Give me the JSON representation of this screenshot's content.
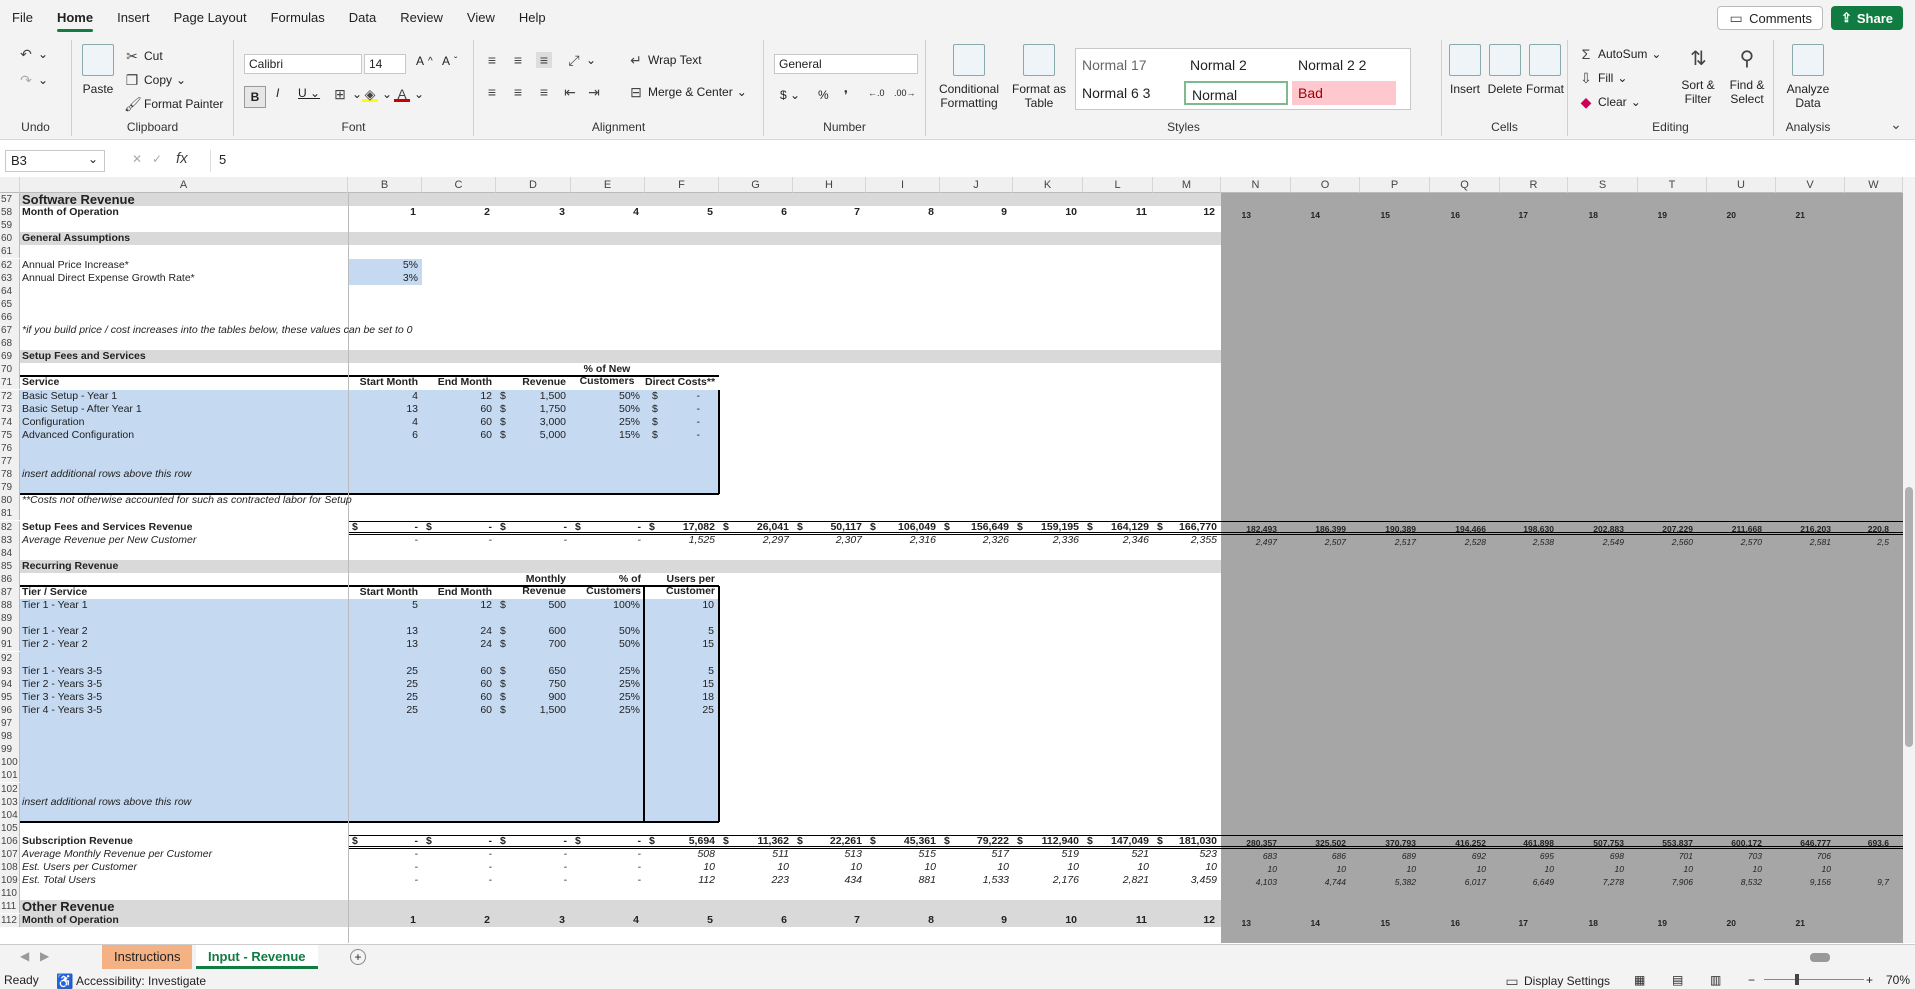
{
  "menu": {
    "items": [
      "File",
      "Home",
      "Insert",
      "Page Layout",
      "Formulas",
      "Data",
      "Review",
      "View",
      "Help"
    ],
    "comments": "Comments",
    "share": "Share"
  },
  "ribbon": {
    "undo": "Undo",
    "clipboard": {
      "paste": "Paste",
      "cut": "Cut",
      "copy": "Copy",
      "format_painter": "Format Painter",
      "label": "Clipboard"
    },
    "font": {
      "name": "Calibri",
      "size": "14",
      "label": "Font"
    },
    "alignment": {
      "wrap": "Wrap Text",
      "merge": "Merge & Center",
      "label": "Alignment"
    },
    "number": {
      "format": "General",
      "label": "Number"
    },
    "styles": {
      "conditional": "Conditional Formatting",
      "format_table": "Format as Table",
      "cells": [
        "Normal 17",
        "Normal 2",
        "Normal 2 2",
        "Normal 6 3",
        "Normal",
        "Bad"
      ],
      "label": "Styles"
    },
    "cells": {
      "insert": "Insert",
      "delete": "Delete",
      "format": "Format",
      "label": "Cells"
    },
    "editing": {
      "autosum": "AutoSum",
      "fill": "Fill",
      "clear": "Clear",
      "sort": "Sort & Filter",
      "find": "Find & Select",
      "label": "Editing"
    },
    "analysis": {
      "analyze": "Analyze Data",
      "label": "Analysis"
    }
  },
  "formula_bar": {
    "name_box": "B3",
    "value": "5"
  },
  "columns": [
    "A",
    "B",
    "C",
    "D",
    "E",
    "F",
    "G",
    "H",
    "I",
    "J",
    "K",
    "L",
    "M",
    "N",
    "O",
    "P",
    "Q",
    "R",
    "S",
    "T",
    "U",
    "V",
    "W"
  ],
  "sheet": {
    "r57": "Software Revenue",
    "r58": "Month of Operation",
    "months_a": [
      "1",
      "2",
      "3",
      "4",
      "5",
      "6",
      "7",
      "8",
      "9",
      "10",
      "11",
      "12"
    ],
    "months_b": [
      "13",
      "14",
      "15",
      "16",
      "17",
      "18",
      "19",
      "20",
      "21"
    ],
    "r60": "General Assumptions",
    "r62": "Annual Price Increase*",
    "r62v": "5%",
    "r63": "Annual Direct Expense Growth Rate*",
    "r63v": "3%",
    "r67": "*if you build price / cost increases into the tables below, these values can be set to 0",
    "r69": "Setup Fees and Services",
    "setup_hdr": [
      "Service",
      "Start Month",
      "End Month",
      "Revenue",
      "% of New Customers",
      "Direct Costs**"
    ],
    "setup_rows": [
      [
        "Basic Setup - Year 1",
        "4",
        "12",
        "$",
        "1,500",
        "50%",
        "$",
        "-"
      ],
      [
        "Basic Setup - After Year 1",
        "13",
        "60",
        "$",
        "1,750",
        "50%",
        "$",
        "-"
      ],
      [
        "Configuration",
        "4",
        "60",
        "$",
        "3,000",
        "25%",
        "$",
        "-"
      ],
      [
        "Advanced Configuration",
        "6",
        "60",
        "$",
        "5,000",
        "15%",
        "$",
        "-"
      ]
    ],
    "insert_note": "insert additional rows above this row",
    "r80": "**Costs not otherwise accounted for such as contracted labor for Setup",
    "r82": "Setup Fees and Services Revenue",
    "r82v": [
      "-",
      "-",
      "-",
      "-",
      "17,082",
      "26,041",
      "50,117",
      "106,049",
      "156,649",
      "159,195",
      "164,129",
      "166,770"
    ],
    "r82w": [
      "182,493",
      "186,399",
      "190,389",
      "194,466",
      "198,630",
      "202,883",
      "207,229",
      "211,668",
      "216,203",
      "220,8"
    ],
    "r83": "Average Revenue per New Customer",
    "r83v": [
      "-",
      "-",
      "-",
      "-",
      "1,525",
      "2,297",
      "2,307",
      "2,316",
      "2,326",
      "2,336",
      "2,346",
      "2,355"
    ],
    "r83w": [
      "2,497",
      "2,507",
      "2,517",
      "2,528",
      "2,538",
      "2,549",
      "2,560",
      "2,570",
      "2,581",
      "2,5"
    ],
    "r85": "Recurring Revenue",
    "rec_hdr": [
      "Tier / Service",
      "Start Month",
      "End Month",
      "Monthly Revenue",
      "% of Customers",
      "Users per Customer"
    ],
    "rec_rows": [
      {
        "row": "88",
        "v": [
          "Tier 1 - Year 1",
          "5",
          "12",
          "$",
          "500",
          "100%",
          "10"
        ]
      },
      {
        "row": "90",
        "v": [
          "Tier 1 - Year 2",
          "13",
          "24",
          "$",
          "600",
          "50%",
          "5"
        ]
      },
      {
        "row": "91",
        "v": [
          "Tier 2 - Year 2",
          "13",
          "24",
          "$",
          "700",
          "50%",
          "15"
        ]
      },
      {
        "row": "93",
        "v": [
          "Tier 1 - Years 3-5",
          "25",
          "60",
          "$",
          "650",
          "25%",
          "5"
        ]
      },
      {
        "row": "94",
        "v": [
          "Tier 2 - Years 3-5",
          "25",
          "60",
          "$",
          "750",
          "25%",
          "15"
        ]
      },
      {
        "row": "95",
        "v": [
          "Tier 3 - Years 3-5",
          "25",
          "60",
          "$",
          "900",
          "25%",
          "18"
        ]
      },
      {
        "row": "96",
        "v": [
          "Tier 4 - Years 3-5",
          "25",
          "60",
          "$",
          "1,500",
          "25%",
          "25"
        ]
      }
    ],
    "r106": "Subscription Revenue",
    "r106v": [
      "-",
      "-",
      "-",
      "-",
      "5,694",
      "11,362",
      "22,261",
      "45,361",
      "79,222",
      "112,940",
      "147,049",
      "181,030"
    ],
    "r106w": [
      "280,357",
      "325,502",
      "370,793",
      "416,252",
      "461,898",
      "507,753",
      "553,837",
      "600,172",
      "646,777",
      "693,6"
    ],
    "r107": "Average Monthly Revenue per Customer",
    "r107v": [
      "-",
      "-",
      "-",
      "-",
      "508",
      "511",
      "513",
      "515",
      "517",
      "519",
      "521",
      "523"
    ],
    "r107w": [
      "683",
      "686",
      "689",
      "692",
      "695",
      "698",
      "701",
      "703",
      "706"
    ],
    "r108": "Est. Users per Customer",
    "r108v": [
      "-",
      "-",
      "-",
      "-",
      "10",
      "10",
      "10",
      "10",
      "10",
      "10",
      "10",
      "10"
    ],
    "r108w": [
      "10",
      "10",
      "10",
      "10",
      "10",
      "10",
      "10",
      "10",
      "10"
    ],
    "r109": "Est. Total Users",
    "r109v": [
      "-",
      "-",
      "-",
      "-",
      "112",
      "223",
      "434",
      "881",
      "1,533",
      "2,176",
      "2,821",
      "3,459"
    ],
    "r109w": [
      "4,103",
      "4,744",
      "5,382",
      "6,017",
      "6,649",
      "7,278",
      "7,906",
      "8,532",
      "9,156",
      "9,7"
    ],
    "r111": "Other Revenue",
    "r112": "Month of Operation"
  },
  "tabs": {
    "t1": "Instructions",
    "t2": "Input - Revenue"
  },
  "status": {
    "ready": "Ready",
    "access": "Accessibility: Investigate",
    "display": "Display Settings",
    "zoom": "70%"
  }
}
